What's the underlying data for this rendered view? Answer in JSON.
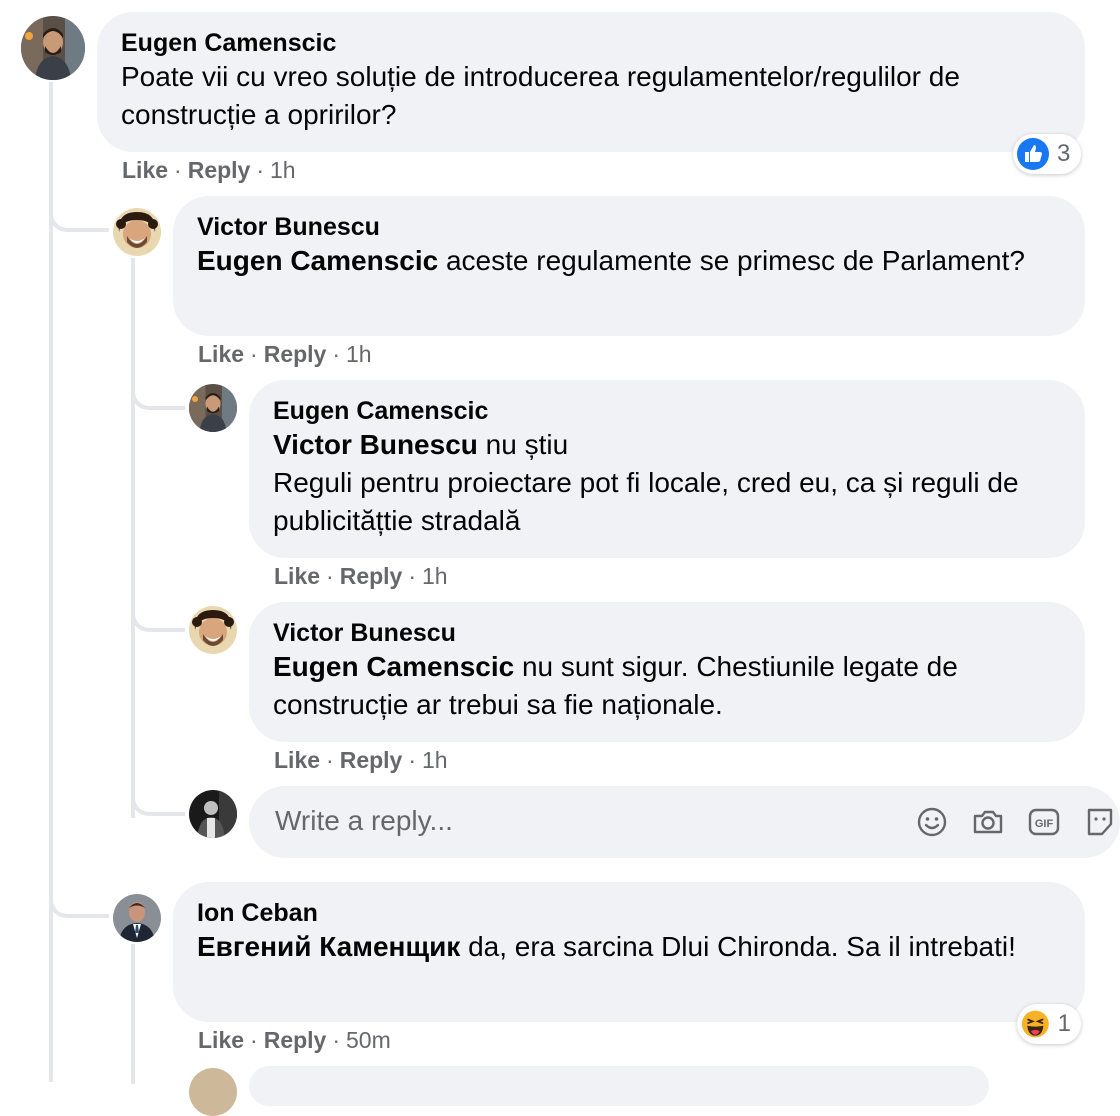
{
  "comment": {
    "author": "Eugen Camenscic",
    "text": "Poate vii cu vreo soluție de introducerea regulamentelor/regulilor de construcție a opririlor?",
    "like": "Like",
    "reply": "Reply",
    "time": "1h",
    "reaction_count": "3",
    "reaction_icon": "like-icon"
  },
  "replies": [
    {
      "author": "Victor Bunescu",
      "mention": "Eugen Camenscic",
      "text": " aceste regulamente se primesc de Parlament?",
      "like": "Like",
      "reply": "Reply",
      "time": "1h"
    },
    {
      "author": "Eugen Camenscic",
      "mention": "Victor Bunescu",
      "text": " nu știu",
      "text2": "Reguli pentru proiectare pot fi locale, cred eu, ca și reguli de publicitățtie stradală",
      "like": "Like",
      "reply": "Reply",
      "time": "1h"
    },
    {
      "author": "Victor Bunescu",
      "mention": "Eugen Camenscic",
      "text": " nu sunt sigur. Chestiunile legate de construcție ar trebui sa fie naționale.",
      "like": "Like",
      "reply": "Reply",
      "time": "1h"
    }
  ],
  "reply_box": {
    "placeholder": "Write a reply...",
    "icons": [
      "emoji-icon",
      "camera-icon",
      "gif-icon",
      "sticker-icon"
    ]
  },
  "comment2": {
    "author": "Ion Ceban",
    "mention": "Евгений Каменщик",
    "text": " da, era sarcina Dlui Chironda. Sa il intrebati!",
    "like": "Like",
    "reply": "Reply",
    "time": "50m",
    "reaction_count": "1",
    "reaction_icon": "haha-icon"
  },
  "colors": {
    "bubble": "#f0f2f5",
    "meta_text": "#65676b",
    "like_blue": "#1877f2",
    "thread_line": "#e4e6eb"
  }
}
